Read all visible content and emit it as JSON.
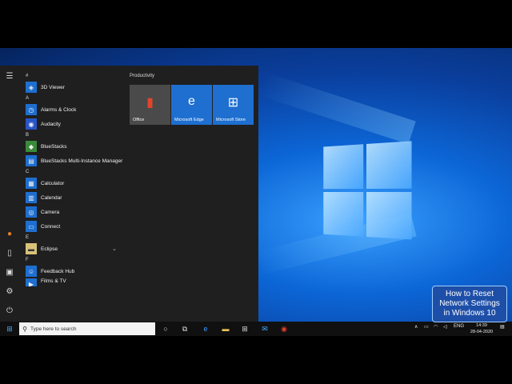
{
  "start_menu": {
    "productivity_label": "Productivity",
    "groups": [
      {
        "letter": "#",
        "apps": [
          "3D Viewer"
        ]
      },
      {
        "letter": "A",
        "apps": [
          "Alarms & Clock",
          "Audacity"
        ]
      },
      {
        "letter": "B",
        "apps": [
          "BlueStacks",
          "BlueStacks Multi-Instance Manager"
        ]
      },
      {
        "letter": "C",
        "apps": [
          "Calculator",
          "Calendar",
          "Camera",
          "Connect"
        ]
      },
      {
        "letter": "E",
        "apps": [
          "Eclipse"
        ]
      },
      {
        "letter": "F",
        "apps": [
          "Feedback Hub",
          "Films & TV"
        ]
      }
    ],
    "tiles": [
      {
        "label": "Office",
        "icon": "office-icon"
      },
      {
        "label": "Microsoft Edge",
        "icon": "edge-icon"
      },
      {
        "label": "Microsoft Store",
        "icon": "store-icon"
      }
    ]
  },
  "taskbar": {
    "search_placeholder": "Type here to search",
    "language": "ENG",
    "time": "14:39",
    "date": "28-04-2020"
  },
  "overlay": {
    "line1": "How to Reset",
    "line2": "Network Settings",
    "line3": "in Windows 10"
  },
  "colors": {
    "accent": "#1e6fd0",
    "menu_bg": "#1f1f1f",
    "taskbar_bg": "#101010"
  }
}
